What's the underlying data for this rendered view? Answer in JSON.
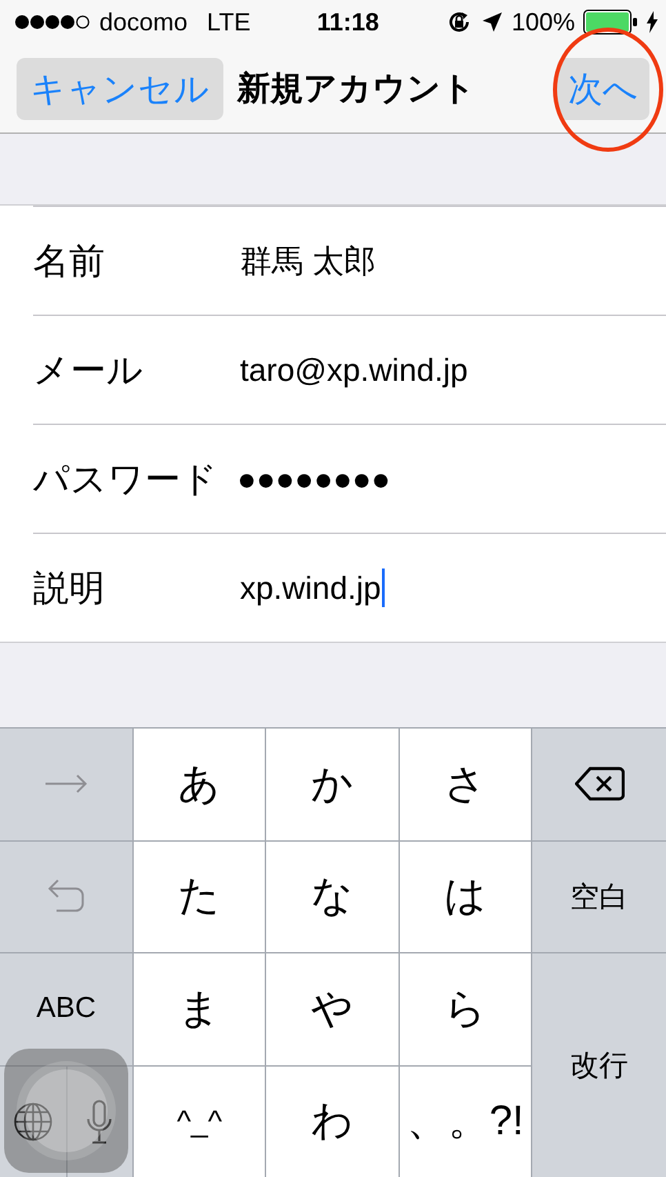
{
  "status_bar": {
    "carrier": "docomo",
    "network": "LTE",
    "time": "11:18",
    "battery": "100%"
  },
  "nav_bar": {
    "cancel": "キャンセル",
    "title": "新規アカウント",
    "next": "次へ",
    "next_highlighted": true
  },
  "fields": [
    {
      "label": "名前",
      "value": "群馬 太郎",
      "focused": false
    },
    {
      "label": "メール",
      "value": "taro@xp.wind.jp",
      "focused": false
    },
    {
      "label": "パスワード",
      "value": "●●●●●●●●",
      "focused": false
    },
    {
      "label": "説明",
      "value": "xp.wind.jp",
      "focused": true
    }
  ],
  "keyboard": {
    "keys": [
      {
        "kind": "next"
      },
      {
        "kind": "char",
        "label": "あ"
      },
      {
        "kind": "char",
        "label": "か"
      },
      {
        "kind": "char",
        "label": "さ"
      },
      {
        "kind": "delete"
      },
      {
        "kind": "undo"
      },
      {
        "kind": "char",
        "label": "た"
      },
      {
        "kind": "char",
        "label": "な"
      },
      {
        "kind": "char",
        "label": "は"
      },
      {
        "kind": "function",
        "label": "空白"
      },
      {
        "kind": "function",
        "label": "ABC"
      },
      {
        "kind": "char",
        "label": "ま"
      },
      {
        "kind": "char",
        "label": "や"
      },
      {
        "kind": "char",
        "label": "ら"
      },
      {
        "kind": "return",
        "label": "改行"
      },
      {
        "kind": "globe"
      },
      {
        "kind": "mic"
      },
      {
        "kind": "emoticon",
        "label": "^_^"
      },
      {
        "kind": "char",
        "label": "わ"
      },
      {
        "kind": "char",
        "label": "、。?!"
      }
    ]
  }
}
